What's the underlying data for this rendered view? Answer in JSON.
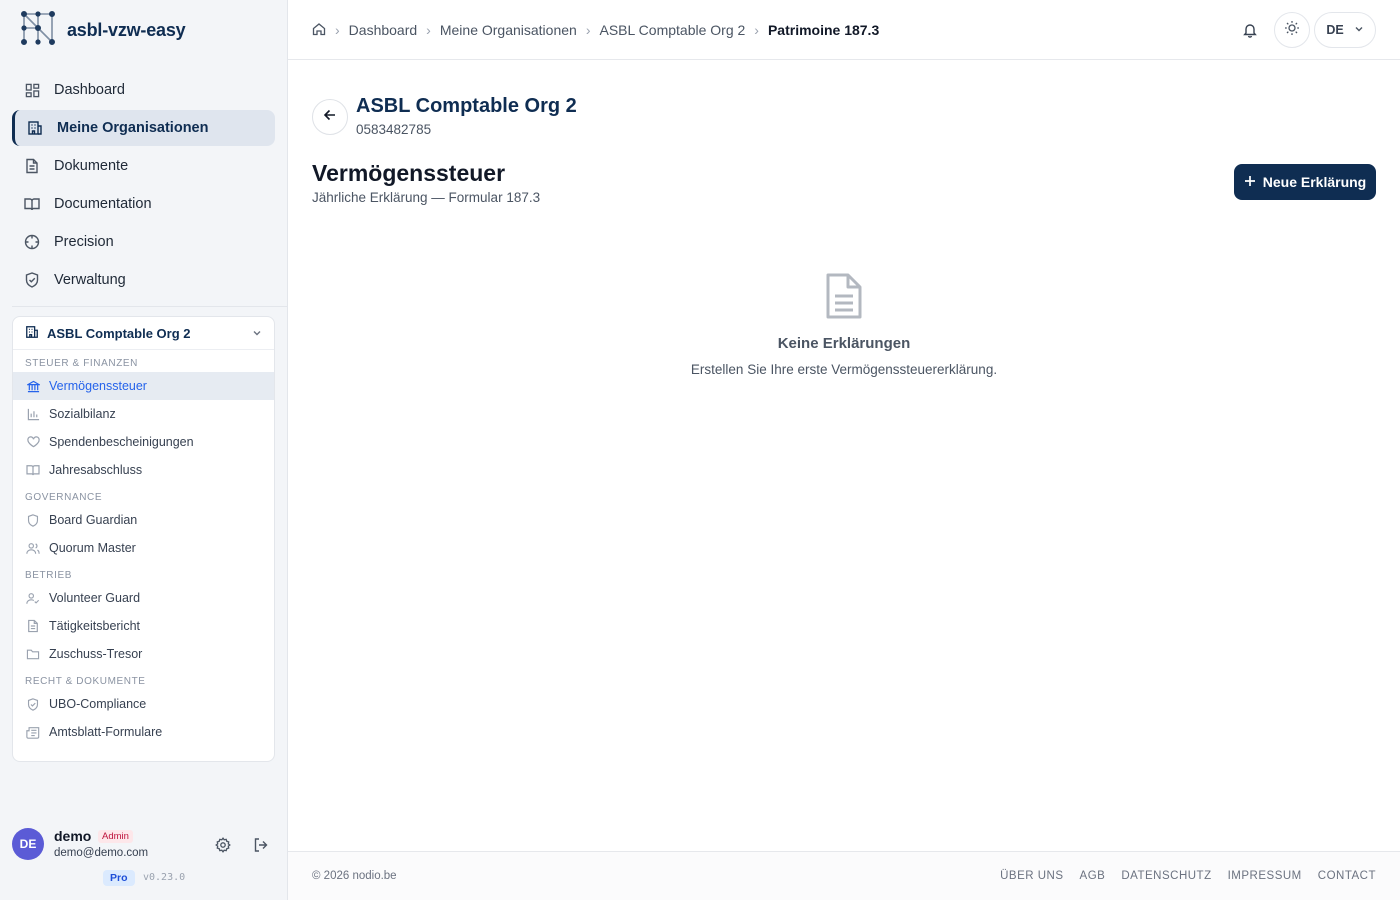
{
  "app": {
    "name": "asbl-vzw-easy"
  },
  "sidebar": {
    "nav": [
      {
        "label": "Dashboard",
        "icon": "dashboard-icon",
        "active": false
      },
      {
        "label": "Meine Organisationen",
        "icon": "building-icon",
        "active": true
      },
      {
        "label": "Dokumente",
        "icon": "file-icon",
        "active": false
      },
      {
        "label": "Documentation",
        "icon": "book-icon",
        "active": false
      },
      {
        "label": "Precision",
        "icon": "crosshair-icon",
        "active": false
      },
      {
        "label": "Verwaltung",
        "icon": "shield-icon",
        "active": false
      }
    ],
    "org": {
      "name": "ASBL Comptable Org 2",
      "sections": [
        {
          "title": "STEUER & FINANZEN",
          "items": [
            {
              "label": "Vermögenssteuer",
              "icon": "bank-icon",
              "active": true
            },
            {
              "label": "Sozialbilanz",
              "icon": "bar-chart-icon",
              "active": false
            },
            {
              "label": "Spendenbescheinigungen",
              "icon": "heart-icon",
              "active": false
            },
            {
              "label": "Jahresabschluss",
              "icon": "book-icon",
              "active": false
            }
          ]
        },
        {
          "title": "GOVERNANCE",
          "items": [
            {
              "label": "Board Guardian",
              "icon": "shield-icon",
              "active": false
            },
            {
              "label": "Quorum Master",
              "icon": "users-icon",
              "active": false
            }
          ]
        },
        {
          "title": "BETRIEB",
          "items": [
            {
              "label": "Volunteer Guard",
              "icon": "user-check-icon",
              "active": false
            },
            {
              "label": "Tätigkeitsbericht",
              "icon": "file-text-icon",
              "active": false
            },
            {
              "label": "Zuschuss-Tresor",
              "icon": "folder-icon",
              "active": false
            }
          ]
        },
        {
          "title": "RECHT & DOKUMENTE",
          "items": [
            {
              "label": "UBO-Compliance",
              "icon": "shield-check-icon",
              "active": false
            },
            {
              "label": "Amtsblatt-Formulare",
              "icon": "newspaper-icon",
              "active": false
            }
          ]
        }
      ]
    },
    "user": {
      "initials": "DE",
      "name": "demo",
      "role_badge": "Admin",
      "email": "demo@demo.com",
      "plan": "Pro",
      "version": "v0.23.0"
    }
  },
  "topbar": {
    "breadcrumb": [
      "Dashboard",
      "Meine Organisationen",
      "ASBL Comptable Org 2"
    ],
    "breadcrumb_current": "Patrimoine 187.3",
    "language": "DE"
  },
  "main": {
    "org_title": "ASBL Comptable Org 2",
    "org_number": "0583482785",
    "page_title": "Vermögenssteuer",
    "page_subtitle": "Jährliche Erklärung — Formular 187.3",
    "new_button": "Neue Erklärung",
    "empty_title": "Keine Erklärungen",
    "empty_text": "Erstellen Sie Ihre erste Vermögenssteuererklärung."
  },
  "footer": {
    "copyright": "© 2026 nodio.be",
    "links": [
      "ÜBER UNS",
      "AGB",
      "DATENSCHUTZ",
      "IMPRESSUM",
      "CONTACT"
    ]
  }
}
